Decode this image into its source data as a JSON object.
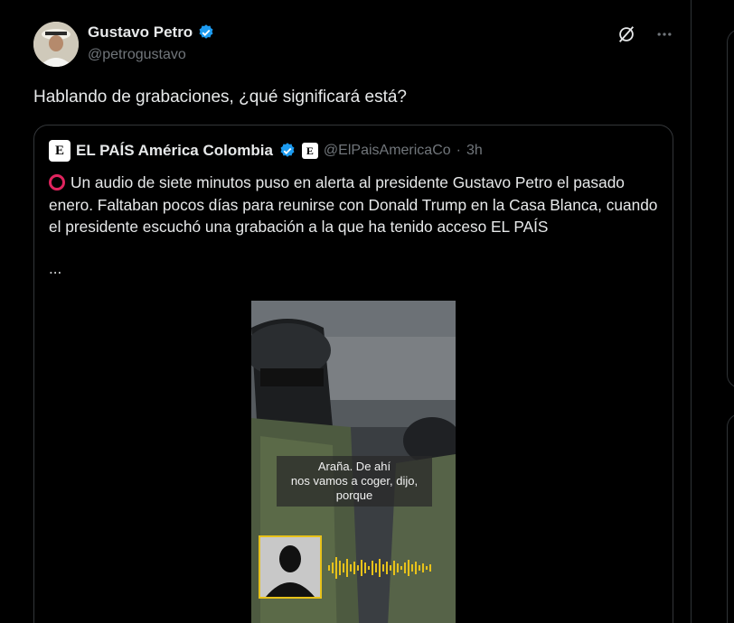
{
  "tweet": {
    "author_name": "Gustavo Petro",
    "author_handle": "@petrogustavo",
    "text": "Hablando de grabaciones, ¿qué significará está?",
    "more_label": "···"
  },
  "quote": {
    "logo_letter": "E",
    "author_name": "EL PAÍS América Colombia",
    "affiliate_letter": "E",
    "author_handle": "@ElPaisAmericaCo",
    "separator": "·",
    "time": "3h",
    "body": "Un audio de siete minutos puso en alerta al presidente Gustavo Petro el pasado enero. Faltaban pocos días para reunirse con Donald Trump en la Casa Blanca, cuando el presidente escuchó una grabación a la que ha tenido acceso EL PAÍS",
    "ellipsis": "...",
    "media": {
      "caption_line1": "Araña. De ahí",
      "caption_line2": "nos vamos a coger, dijo,",
      "caption_line3": "porque"
    }
  },
  "colors": {
    "verified_blue": "#1d9bf0",
    "accent_yellow": "#e8c21a",
    "alert_red": "#e0245e"
  }
}
